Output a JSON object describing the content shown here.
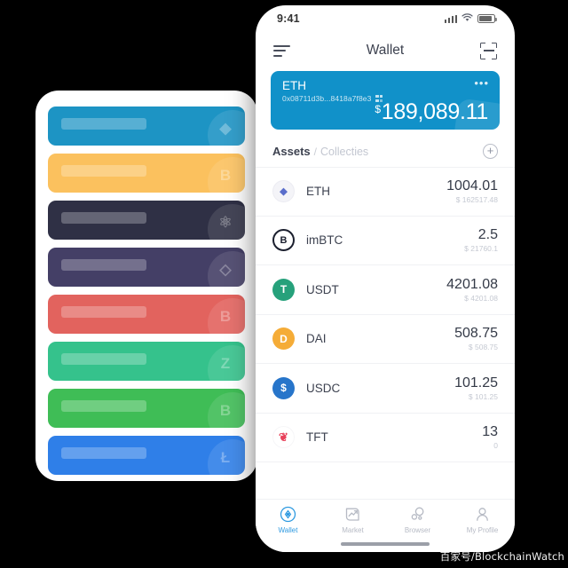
{
  "watermark": "百家号/BlockchainWatch",
  "left_panel": {
    "name": "coin-card-stack",
    "cards": [
      {
        "color": "#1d94c4",
        "glyph": "◆",
        "coin": "eth"
      },
      {
        "color": "#fbc15e",
        "glyph": "B",
        "coin": "btc"
      },
      {
        "color": "#2f3045",
        "glyph": "⚛",
        "coin": "eos"
      },
      {
        "color": "#443f66",
        "glyph": "◇",
        "coin": "xrp"
      },
      {
        "color": "#e2635e",
        "glyph": "В",
        "coin": "bch"
      },
      {
        "color": "#35c28c",
        "glyph": "Z",
        "coin": "zec"
      },
      {
        "color": "#3fbd56",
        "glyph": "B",
        "coin": "bsv"
      },
      {
        "color": "#2f7fe8",
        "glyph": "Ł",
        "coin": "ltc"
      }
    ]
  },
  "phone": {
    "statusbar": {
      "clock": "9:41",
      "signal_icon": "signal-bars-icon",
      "wifi_icon": "wifi-icon",
      "battery_icon": "battery-icon"
    },
    "navbar": {
      "menu_icon": "hamburger-menu-icon",
      "title": "Wallet",
      "scan_icon": "scan-qr-icon"
    },
    "balance_card": {
      "accent_color": "#1191c9",
      "wallet_name": "ETH",
      "address": "0x08711d3b...8418a7f8e3",
      "qr_icon": "qr-code-icon",
      "more_icon": "•••",
      "currency_symbol": "$",
      "total_balance": "189,089.11"
    },
    "assets_header": {
      "tab_assets": "Assets",
      "separator": "/",
      "tab_collectibles": "Collecties",
      "add_icon": "plus-icon"
    },
    "assets": [
      {
        "symbol": "ETH",
        "amount": "1004.01",
        "fiat": "$ 162517.48",
        "icon_name": "eth-token-icon",
        "icon_bg": "#f4f4f8",
        "icon_fg": "#5a6ecb",
        "icon_glyph": "◆"
      },
      {
        "symbol": "imBTC",
        "amount": "2.5",
        "fiat": "$ 21760.1",
        "icon_name": "imbtc-token-icon",
        "icon_bg": "#1b1f2e",
        "icon_fg": "#ffffff",
        "icon_glyph": "B"
      },
      {
        "symbol": "USDT",
        "amount": "4201.08",
        "fiat": "$ 4201.08",
        "icon_name": "usdt-token-icon",
        "icon_bg": "#26a17b",
        "icon_fg": "#ffffff",
        "icon_glyph": "T"
      },
      {
        "symbol": "DAI",
        "amount": "508.75",
        "fiat": "$ 508.75",
        "icon_name": "dai-token-icon",
        "icon_bg": "#f5ac37",
        "icon_fg": "#ffffff",
        "icon_glyph": "D"
      },
      {
        "symbol": "USDC",
        "amount": "101.25",
        "fiat": "$ 101.25",
        "icon_name": "usdc-token-icon",
        "icon_bg": "#2775ca",
        "icon_fg": "#ffffff",
        "icon_glyph": "$"
      },
      {
        "symbol": "TFT",
        "amount": "13",
        "fiat": "0",
        "icon_name": "tft-token-icon",
        "icon_bg": "#ffffff",
        "icon_fg": "#e8415a",
        "icon_glyph": "❦"
      }
    ],
    "tabbar": {
      "active_color": "#2f9ae0",
      "inactive_color": "#b6bac4",
      "tabs": [
        {
          "label": "Wallet",
          "icon_name": "wallet-diamond-icon",
          "active": true
        },
        {
          "label": "Market",
          "icon_name": "market-chart-icon",
          "active": false
        },
        {
          "label": "Browser",
          "icon_name": "browser-bubbles-icon",
          "active": false
        },
        {
          "label": "My Profile",
          "icon_name": "user-profile-icon",
          "active": false
        }
      ]
    }
  }
}
